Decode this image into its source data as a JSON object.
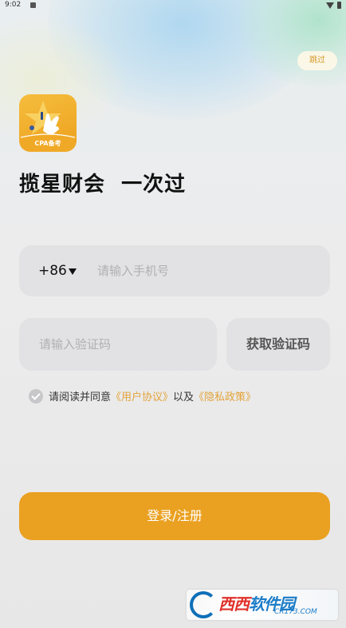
{
  "status_bar": {
    "time": "9:02"
  },
  "header": {
    "skip_label": "跳过"
  },
  "logo": {
    "text": "CPA备考",
    "icon": "star-hand-logo-icon"
  },
  "tagline": "揽星财会  一次过",
  "login_form": {
    "country_code": "+86",
    "phone_placeholder": "请输入手机号",
    "code_placeholder": "请输入验证码",
    "get_code_label": "获取验证码"
  },
  "agreement": {
    "prefix": "请阅读并同意",
    "user_agreement": "《用户协议》",
    "conjunction": "以及",
    "privacy_policy": "《隐私政策》",
    "checked": true
  },
  "login_button_label": "登录/注册",
  "watermark": {
    "title_part1": "西西",
    "title_part2": "软件园",
    "subtitle": "CR173.COM"
  },
  "colors": {
    "accent": "#eaa020",
    "link": "#e3a33a",
    "field_bg": "#e2e2e4"
  }
}
